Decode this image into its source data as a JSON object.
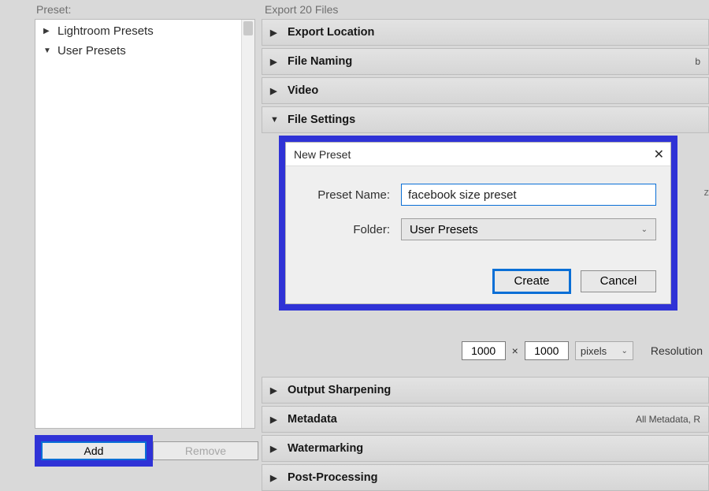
{
  "left": {
    "header": "Preset:",
    "items": [
      {
        "label": "Lightroom Presets",
        "expanded": false
      },
      {
        "label": "User Presets",
        "expanded": true
      }
    ],
    "add_label": "Add",
    "remove_label": "Remove"
  },
  "right": {
    "header": "Export 20 Files",
    "panels": {
      "export_location": "Export Location",
      "file_naming": {
        "label": "File Naming",
        "meta": "b"
      },
      "video": "Video",
      "file_settings": "File Settings",
      "output_sharpening": "Output Sharpening",
      "metadata": {
        "label": "Metadata",
        "meta": "All Metadata, R"
      },
      "watermarking": "Watermarking",
      "post_processing": "Post-Processing"
    },
    "resize": {
      "w": "1000",
      "times": "×",
      "h": "1000",
      "units": "pixels",
      "resolution_label": "Resolution"
    }
  },
  "modal": {
    "title": "New Preset",
    "name_label": "Preset Name:",
    "name_value": "facebook size preset",
    "folder_label": "Folder:",
    "folder_value": "User Presets",
    "create": "Create",
    "cancel": "Cancel"
  },
  "edge_ghost": "z"
}
